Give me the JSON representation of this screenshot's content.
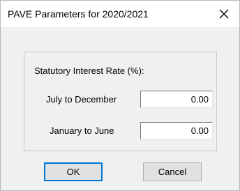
{
  "window": {
    "title": "PAVE Parameters for 2020/2021",
    "close_icon": "close-icon"
  },
  "group": {
    "label": "Statutory Interest Rate (%):"
  },
  "fields": {
    "july_to_december": {
      "label": "July to December",
      "value": "0.00"
    },
    "january_to_june": {
      "label": "January to June",
      "value": "0.00"
    }
  },
  "buttons": {
    "ok_label": "OK",
    "cancel_label": "Cancel"
  },
  "colors": {
    "dialog_background": "#f0f0f0",
    "titlebar_background": "#ffffff",
    "default_button_border": "#0078d7"
  }
}
